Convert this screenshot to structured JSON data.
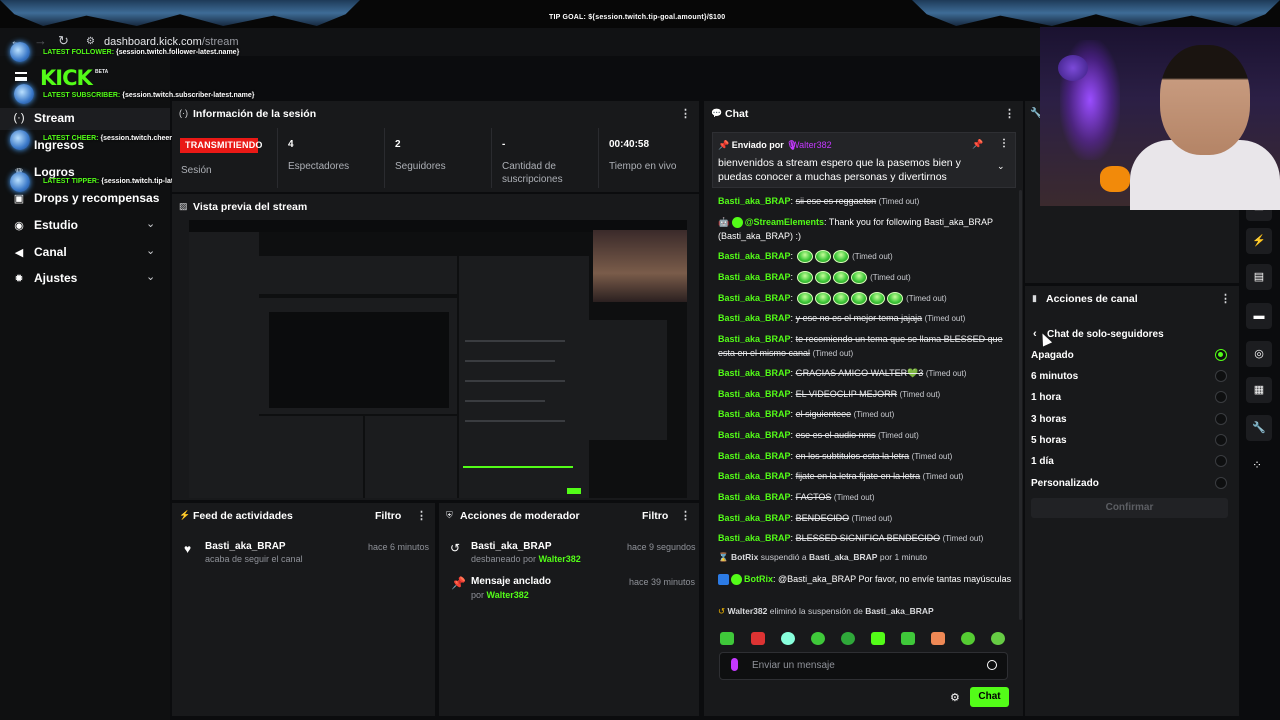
{
  "overlay": {
    "tip_goal": "TIP GOAL: ${session.twitch.tip-goal.amount}/$100",
    "alerts": [
      {
        "label": "LATEST FOLLOWER:",
        "value": "{session.twitch.follower-latest.name}"
      },
      {
        "label": "LATEST SUBSCRIBER:",
        "value": "{session.twitch.subscriber-latest.name}"
      },
      {
        "label": "LATEST CHEER:",
        "value": "{session.twitch.cheer-latest.name} - {session.twitch.cheer-latest.amount}"
      },
      {
        "label": "LATEST TIPPER:",
        "value": "{session.twitch.tip-latest.name} - {session.twitch.tip-latest.amount}"
      }
    ]
  },
  "browser": {
    "url_host": "dashboard.kick.com",
    "url_path": "/stream"
  },
  "brand": {
    "logo": "KICK",
    "beta": "BETA"
  },
  "sidebar": {
    "items": [
      {
        "label": "Stream",
        "icon": "broadcast-icon"
      },
      {
        "label": "Ingresos",
        "icon": "dollar-icon"
      },
      {
        "label": "Logros",
        "icon": "trophy-icon"
      },
      {
        "label": "Drops y recompensas",
        "icon": "gift-icon"
      },
      {
        "label": "Estudio",
        "icon": "camera-icon"
      },
      {
        "label": "Canal",
        "icon": "megaphone-icon"
      },
      {
        "label": "Ajustes",
        "icon": "gear-icon"
      }
    ]
  },
  "session": {
    "title": "Información de la sesión",
    "status": "TRANSMITIENDO",
    "session_label": "Sesión",
    "stats": [
      {
        "value": "4",
        "label": "Espectadores"
      },
      {
        "value": "2",
        "label": "Seguidores"
      },
      {
        "value": "-",
        "label": "Cantidad de suscripciones"
      },
      {
        "value": "00:40:58",
        "label": "Tiempo en vivo"
      }
    ]
  },
  "preview": {
    "title": "Vista previa del stream"
  },
  "feed": {
    "title": "Feed de actividades",
    "filter": "Filtro",
    "items": [
      {
        "name": "Basti_aka_BRAP",
        "sub": "acaba de seguir el canal",
        "time": "hace 6 minutos"
      }
    ]
  },
  "mod": {
    "title": "Acciones de moderador",
    "filter": "Filtro",
    "items": [
      {
        "name": "Basti_aka_BRAP",
        "action": "desbaneado por",
        "by": "Walter382",
        "time": "hace 9 segundos"
      },
      {
        "name": "Mensaje anclado",
        "action": "por",
        "by": "Walter382",
        "time": "hace 39 minutos"
      }
    ]
  },
  "chat": {
    "title": "Chat",
    "pinned": {
      "sent_by": "Enviado por",
      "user": "Walter382",
      "text": "bienvenidos a stream espero que la pasemos bien y puedas conocer a muchas personas y divertirnos"
    },
    "messages": [
      {
        "user": "Basti_aka_BRAP",
        "text": "sii ese es reggaeton",
        "timeout": "(Timed out)"
      },
      {
        "user": "@StreamElements",
        "text": "Thank you for following Basti_aka_BRAP (Basti_aka_BRAP) :)"
      },
      {
        "user": "Basti_aka_BRAP",
        "emotes": 3,
        "timeout": "(Timed out)"
      },
      {
        "user": "Basti_aka_BRAP",
        "emotes": 4,
        "timeout": "(Timed out)"
      },
      {
        "user": "Basti_aka_BRAP",
        "emotes": 6,
        "timeout": "(Timed out)"
      },
      {
        "user": "Basti_aka_BRAP",
        "text": "y ese no es el mejor tema jajaja",
        "timeout": "(Timed out)"
      },
      {
        "user": "Basti_aka_BRAP",
        "text": "te recomiendo un tema que se llama BLESSED que esta en el mismo canal",
        "timeout": "(Timed out)"
      },
      {
        "user": "Basti_aka_BRAP",
        "text": "GRACIAS AMIGO WALTER💚3",
        "timeout": "(Timed out)"
      },
      {
        "user": "Basti_aka_BRAP",
        "text": "EL VIDEOCLIP MEJORR",
        "timeout": "(Timed out)"
      },
      {
        "user": "Basti_aka_BRAP",
        "text": "el siguienteee",
        "timeout": "(Timed out)"
      },
      {
        "user": "Basti_aka_BRAP",
        "text": "ese es el audio nms",
        "timeout": "(Timed out)"
      },
      {
        "user": "Basti_aka_BRAP",
        "text": "en los subtitulos esta la letra",
        "timeout": "(Timed out)"
      },
      {
        "user": "Basti_aka_BRAP",
        "text": "fijate en la letra fijate en la letra",
        "timeout": "(Timed out)"
      },
      {
        "user": "Basti_aka_BRAP",
        "text": "FACTOS",
        "timeout": "(Timed out)"
      },
      {
        "user": "Basti_aka_BRAP",
        "text": "BENDECIDO",
        "timeout": "(Timed out)"
      },
      {
        "user": "Basti_aka_BRAP",
        "text": "BLESSED SIGNIFICA BENDECIDO",
        "timeout": "(Timed out)"
      }
    ],
    "sys1": {
      "actor": "BotRix",
      "verb": "suspendió a",
      "target": "Basti_aka_BRAP",
      "tail": "por 1 minuto"
    },
    "botrix": {
      "user": "BotRix",
      "text": "@Basti_aka_BRAP Por favor, no envíe tantas mayúsculas"
    },
    "sys2": {
      "actor": "Walter382",
      "verb": "eliminó la suspensión de",
      "target": "Basti_aka_BRAP"
    },
    "input_placeholder": "Enviar un mensaje",
    "send": "Chat"
  },
  "channel": {
    "title": "Acciones de canal",
    "sub_title": "Chat de solo-seguidores",
    "options": [
      "Apagado",
      "6 minutos",
      "1 hora",
      "3 horas",
      "5 horas",
      "1 día",
      "Personalizado"
    ],
    "selected": "Apagado",
    "confirm": "Confirmar"
  },
  "colors": {
    "accent": "#53fc18",
    "live": "#e91916",
    "panel": "#18191b",
    "pinned_user": "#c438ff"
  }
}
